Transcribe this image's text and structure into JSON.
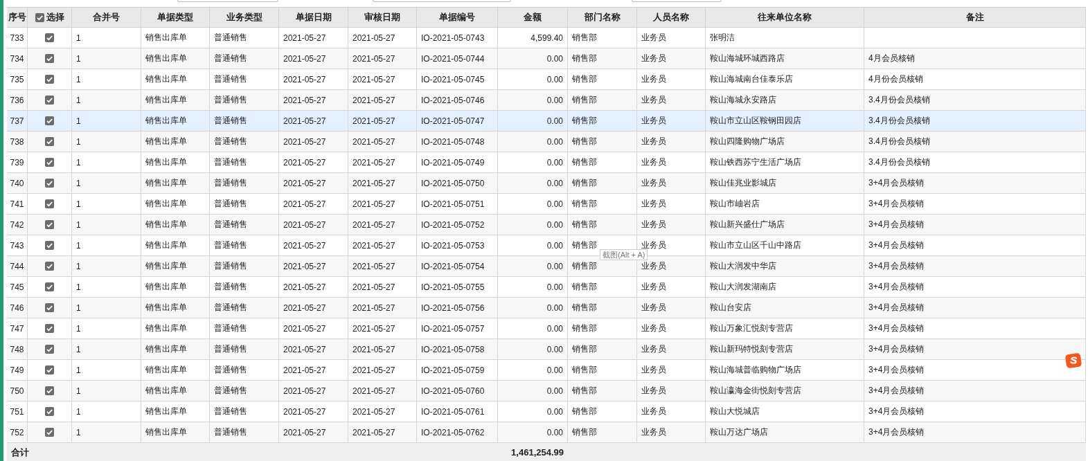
{
  "top_fields": [
    {
      "kind": "field"
    },
    {
      "kind": "field"
    },
    {
      "kind": "field"
    }
  ],
  "table": {
    "columns": [
      "序号",
      "选择",
      "合并号",
      "单据类型",
      "业务类型",
      "单据日期",
      "审核日期",
      "单据编号",
      "金额",
      "部门名称",
      "人员名称",
      "往来单位名称",
      "备注"
    ],
    "select_all_checked": true,
    "rows": [
      {
        "seq": "733",
        "checked": true,
        "selected": false,
        "merge": "1",
        "doc_type": "销售出库单",
        "biz_type": "普通销售",
        "doc_date": "2021-05-27",
        "audit_date": "2021-05-27",
        "doc_no": "IO-2021-05-0743",
        "amount": "4,599.40",
        "dept": "销售部",
        "person": "业务员",
        "partner": "张明洁"
      },
      {
        "seq": "734",
        "checked": true,
        "selected": false,
        "merge": "1",
        "doc_type": "销售出库单",
        "biz_type": "普通销售",
        "doc_date": "2021-05-27",
        "audit_date": "2021-05-27",
        "doc_no": "IO-2021-05-0744",
        "amount": "0.00",
        "dept": "销售部",
        "person": "业务员",
        "partner": "鞍山海城环城西路店",
        "note": "4月会员核销"
      },
      {
        "seq": "735",
        "checked": true,
        "selected": false,
        "merge": "1",
        "doc_type": "销售出库单",
        "biz_type": "普通销售",
        "doc_date": "2021-05-27",
        "audit_date": "2021-05-27",
        "doc_no": "IO-2021-05-0745",
        "amount": "0.00",
        "dept": "销售部",
        "person": "业务员",
        "partner": "鞍山海城南台佳泰乐店",
        "note": "4月份会员核销"
      },
      {
        "seq": "736",
        "checked": true,
        "selected": false,
        "merge": "1",
        "doc_type": "销售出库单",
        "biz_type": "普通销售",
        "doc_date": "2021-05-27",
        "audit_date": "2021-05-27",
        "doc_no": "IO-2021-05-0746",
        "amount": "0.00",
        "dept": "销售部",
        "person": "业务员",
        "partner": "鞍山海城永安路店",
        "note": "3.4月份会员核销"
      },
      {
        "seq": "737",
        "checked": true,
        "selected": true,
        "merge": "1",
        "doc_type": "销售出库单",
        "biz_type": "普通销售",
        "doc_date": "2021-05-27",
        "audit_date": "2021-05-27",
        "doc_no": "IO-2021-05-0747",
        "amount": "0.00",
        "dept": "销售部",
        "person": "业务员",
        "partner": "鞍山市立山区鞍钢田园店",
        "note": "3.4月份会员核销"
      },
      {
        "seq": "738",
        "checked": true,
        "selected": false,
        "merge": "1",
        "doc_type": "销售出库单",
        "biz_type": "普通销售",
        "doc_date": "2021-05-27",
        "audit_date": "2021-05-27",
        "doc_no": "IO-2021-05-0748",
        "amount": "0.00",
        "dept": "销售部",
        "person": "业务员",
        "partner": "鞍山四隆购物广场店",
        "note": "3.4月份会员核销"
      },
      {
        "seq": "739",
        "checked": true,
        "selected": false,
        "merge": "1",
        "doc_type": "销售出库单",
        "biz_type": "普通销售",
        "doc_date": "2021-05-27",
        "audit_date": "2021-05-27",
        "doc_no": "IO-2021-05-0749",
        "amount": "0.00",
        "dept": "销售部",
        "person": "业务员",
        "partner": "鞍山铁西苏宁生活广场店",
        "note": "3.4月份会员核销"
      },
      {
        "seq": "740",
        "checked": true,
        "selected": false,
        "merge": "1",
        "doc_type": "销售出库单",
        "biz_type": "普通销售",
        "doc_date": "2021-05-27",
        "audit_date": "2021-05-27",
        "doc_no": "IO-2021-05-0750",
        "amount": "0.00",
        "dept": "销售部",
        "person": "业务员",
        "partner": "鞍山佳兆业影城店",
        "note": "3+4月会员核销"
      },
      {
        "seq": "741",
        "checked": true,
        "selected": false,
        "merge": "1",
        "doc_type": "销售出库单",
        "biz_type": "普通销售",
        "doc_date": "2021-05-27",
        "audit_date": "2021-05-27",
        "doc_no": "IO-2021-05-0751",
        "amount": "0.00",
        "dept": "销售部",
        "person": "业务员",
        "partner": "鞍山市岫岩店",
        "note": "3+4月会员核销"
      },
      {
        "seq": "742",
        "checked": true,
        "selected": false,
        "merge": "1",
        "doc_type": "销售出库单",
        "biz_type": "普通销售",
        "doc_date": "2021-05-27",
        "audit_date": "2021-05-27",
        "doc_no": "IO-2021-05-0752",
        "amount": "0.00",
        "dept": "销售部",
        "person": "业务员",
        "partner": "鞍山新兴盛仕广场店",
        "note": "3+4月会员核销"
      },
      {
        "seq": "743",
        "checked": true,
        "selected": false,
        "merge": "1",
        "doc_type": "销售出库单",
        "biz_type": "普通销售",
        "doc_date": "2021-05-27",
        "audit_date": "2021-05-27",
        "doc_no": "IO-2021-05-0753",
        "amount": "0.00",
        "dept": "销售部",
        "person": "业务员",
        "partner": "鞍山市立山区千山中路店",
        "note": "3+4月会员核销"
      },
      {
        "seq": "744",
        "checked": true,
        "selected": false,
        "merge": "1",
        "doc_type": "销售出库单",
        "biz_type": "普通销售",
        "doc_date": "2021-05-27",
        "audit_date": "2021-05-27",
        "doc_no": "IO-2021-05-0754",
        "amount": "0.00",
        "dept": "销售部",
        "person": "业务员",
        "partner": "鞍山大润发中华店",
        "note": "3+4月会员核销"
      },
      {
        "seq": "745",
        "checked": true,
        "selected": false,
        "merge": "1",
        "doc_type": "销售出库单",
        "biz_type": "普通销售",
        "doc_date": "2021-05-27",
        "audit_date": "2021-05-27",
        "doc_no": "IO-2021-05-0755",
        "amount": "0.00",
        "dept": "销售部",
        "person": "业务员",
        "partner": "鞍山大润发湖南店",
        "note": "3+4月会员核销"
      },
      {
        "seq": "746",
        "checked": true,
        "selected": false,
        "merge": "1",
        "doc_type": "销售出库单",
        "biz_type": "普通销售",
        "doc_date": "2021-05-27",
        "audit_date": "2021-05-27",
        "doc_no": "IO-2021-05-0756",
        "amount": "0.00",
        "dept": "销售部",
        "person": "业务员",
        "partner": "鞍山台安店",
        "note": "3+4月会员核销"
      },
      {
        "seq": "747",
        "checked": true,
        "selected": false,
        "merge": "1",
        "doc_type": "销售出库单",
        "biz_type": "普通销售",
        "doc_date": "2021-05-27",
        "audit_date": "2021-05-27",
        "doc_no": "IO-2021-05-0757",
        "amount": "0.00",
        "dept": "销售部",
        "person": "业务员",
        "partner": "鞍山万象汇悦刻专营店",
        "note": "3+4月会员核销"
      },
      {
        "seq": "748",
        "checked": true,
        "selected": false,
        "merge": "1",
        "doc_type": "销售出库单",
        "biz_type": "普通销售",
        "doc_date": "2021-05-27",
        "audit_date": "2021-05-27",
        "doc_no": "IO-2021-05-0758",
        "amount": "0.00",
        "dept": "销售部",
        "person": "业务员",
        "partner": "鞍山新玛特悦刻专营店",
        "note": "3+4月会员核销"
      },
      {
        "seq": "749",
        "checked": true,
        "selected": false,
        "merge": "1",
        "doc_type": "销售出库单",
        "biz_type": "普通销售",
        "doc_date": "2021-05-27",
        "audit_date": "2021-05-27",
        "doc_no": "IO-2021-05-0759",
        "amount": "0.00",
        "dept": "销售部",
        "person": "业务员",
        "partner": "鞍山海城普临购物广场店",
        "note": "3+4月会员核销"
      },
      {
        "seq": "750",
        "checked": true,
        "selected": false,
        "merge": "1",
        "doc_type": "销售出库单",
        "biz_type": "普通销售",
        "doc_date": "2021-05-27",
        "audit_date": "2021-05-27",
        "doc_no": "IO-2021-05-0760",
        "amount": "0.00",
        "dept": "销售部",
        "person": "业务员",
        "partner": "鞍山瀛海金街悦刻专营店",
        "note": "3+4月会员核销"
      },
      {
        "seq": "751",
        "checked": true,
        "selected": false,
        "merge": "1",
        "doc_type": "销售出库单",
        "biz_type": "普通销售",
        "doc_date": "2021-05-27",
        "audit_date": "2021-05-27",
        "doc_no": "IO-2021-05-0761",
        "amount": "0.00",
        "dept": "销售部",
        "person": "业务员",
        "partner": "鞍山大悦城店",
        "note": "3+4月会员核销"
      },
      {
        "seq": "752",
        "checked": true,
        "selected": false,
        "merge": "1",
        "doc_type": "销售出库单",
        "biz_type": "普通销售",
        "doc_date": "2021-05-27",
        "audit_date": "2021-05-27",
        "doc_no": "IO-2021-05-0762",
        "amount": "0.00",
        "dept": "销售部",
        "person": "业务员",
        "partner": "鞍山万达广场店",
        "note": "3+4月会员核销"
      }
    ],
    "footer": {
      "label": "合计",
      "amount_total": "1,461,254.99"
    }
  },
  "tooltip": {
    "text": "截图(Alt + A)"
  }
}
